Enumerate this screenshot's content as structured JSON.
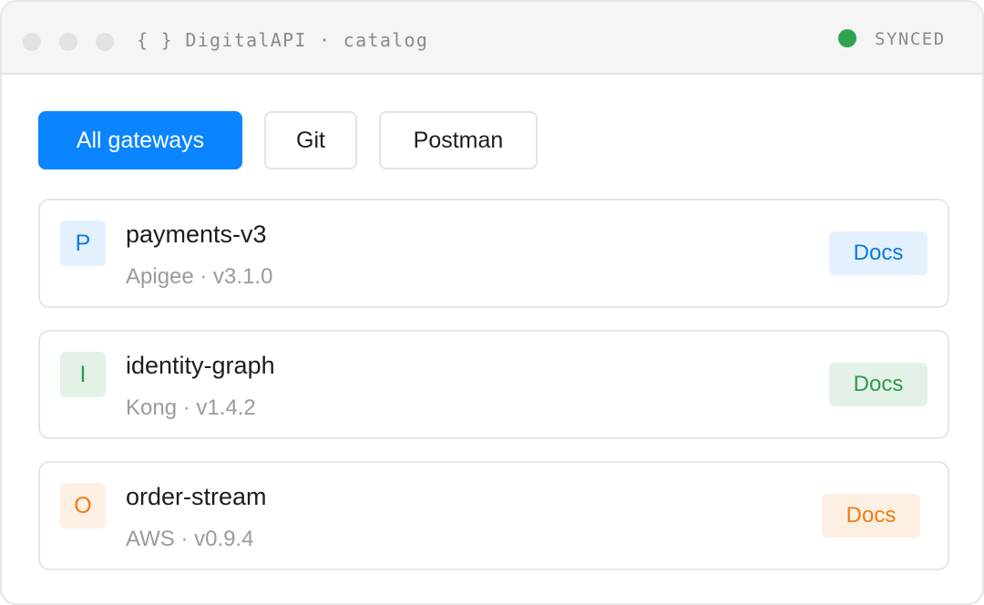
{
  "window": {
    "title": "{ } DigitalAPI · catalog",
    "status": {
      "label": "SYNCED",
      "color": "#2ea44f"
    }
  },
  "filters": [
    {
      "label": "All gateways",
      "active": true
    },
    {
      "label": "Git",
      "active": false
    },
    {
      "label": "Postman",
      "active": false
    }
  ],
  "apis": [
    {
      "initial": "P",
      "name": "payments-v3",
      "meta": "Apigee · v3.1.0",
      "docs_label": "Docs",
      "accent": "#0a7be0",
      "tint": "#e3f0fd"
    },
    {
      "initial": "I",
      "name": "identity-graph",
      "meta": "Kong · v1.4.2",
      "docs_label": "Docs",
      "accent": "#2e9a4e",
      "tint": "#e3f1e7"
    },
    {
      "initial": "O",
      "name": "order-stream",
      "meta": "AWS · v0.9.4",
      "docs_label": "Docs",
      "accent": "#f07c12",
      "tint": "#fdefe2"
    }
  ]
}
